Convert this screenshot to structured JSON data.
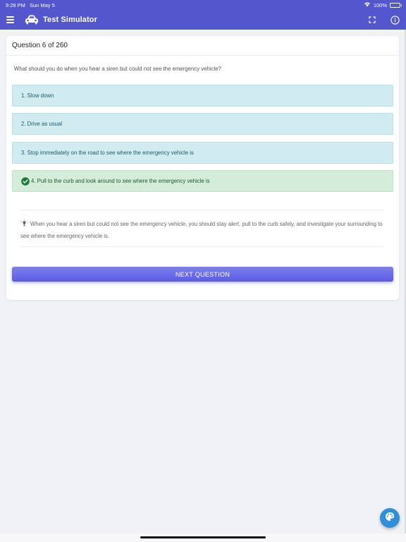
{
  "status_bar": {
    "time": "9:28 PM",
    "date": "Sun May 5",
    "battery": "100%"
  },
  "app_bar": {
    "title": "Test Simulator"
  },
  "quiz": {
    "progress_label": "Question 6 of 260",
    "question": "What should you do when you hear a siren but could not see the emergency vehicle?",
    "answers": [
      {
        "label": "1. Slow down"
      },
      {
        "label": "2. Drive as usual"
      },
      {
        "label": "3. Stop immediately on the road to see where the emergency vehicle is"
      },
      {
        "label": "4. Pull to the curb and look around to see where the emergency vehicle is"
      }
    ],
    "explanation": "When you hear a siren but could not see the emergency vehicle, you should stay alert, pull to the curb safely, and investigate your surrounding to see where the emergency vehicle is.",
    "next_button_label": "NEXT QUESTION"
  },
  "colors": {
    "accent": "#5356cc",
    "answer_bg": "#d0ecf0",
    "correct_bg": "#d4edda",
    "button": "#6769e8",
    "fab": "#2f8fd8"
  },
  "icons": [
    "wifi-icon",
    "battery-icon",
    "menu-icon",
    "car-icon",
    "fullscreen-icon",
    "info-icon",
    "check-circle-icon",
    "lightbulb-icon",
    "palette-icon"
  ]
}
